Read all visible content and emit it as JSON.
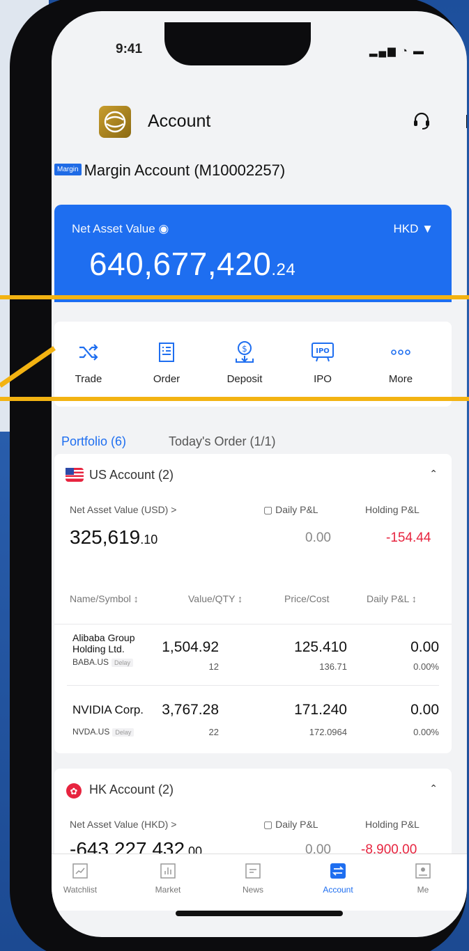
{
  "status": {
    "time": "9:41",
    "icons": "▂▄▆ ◔ ▬"
  },
  "header": {
    "title": "Account"
  },
  "account": {
    "tag": "Margin",
    "name": "Margin Account (M10002257)"
  },
  "nav": {
    "label": "Net Asset Value",
    "currency": "HKD",
    "value_main": "640,677,420",
    "value_dec": ".24"
  },
  "actions": [
    {
      "label": "Trade",
      "icon": "shuffle-icon"
    },
    {
      "label": "Order",
      "icon": "order-list-icon"
    },
    {
      "label": "Deposit",
      "icon": "deposit-icon"
    },
    {
      "label": "IPO",
      "icon": "ipo-icon"
    },
    {
      "label": "More",
      "icon": "more-dots-icon"
    }
  ],
  "tabs": {
    "portfolio": "Portfolio (6)",
    "orders": "Today's Order (1/1)"
  },
  "us": {
    "title": "US Account (2)",
    "nav_label": "Net Asset Value (USD)",
    "nav_main": "325,619",
    "nav_dec": ".10",
    "daily_label": "Daily P&L",
    "daily_value": "0.00",
    "holding_label": "Holding P&L",
    "holding_value": "-154.44",
    "columns": [
      "Name/Symbol ↕",
      "Value/QTY ↕",
      "Price/Cost",
      "Daily P&L ↕"
    ],
    "rows": [
      {
        "name1": "Alibaba Group",
        "name2": "Holding Ltd.",
        "symbol": "BABA.US",
        "delay": "Delay",
        "value": "1,504.92",
        "qty": "12",
        "price": "125.410",
        "cost": "136.71",
        "pl": "0.00",
        "pl_pct": "0.00%"
      },
      {
        "name1": "NVIDIA Corp.",
        "name2": "",
        "symbol": "NVDA.US",
        "delay": "Delay",
        "value": "3,767.28",
        "qty": "22",
        "price": "171.240",
        "cost": "172.0964",
        "pl": "0.00",
        "pl_pct": "0.00%"
      }
    ]
  },
  "hk": {
    "title": "HK Account (2)",
    "nav_label": "Net Asset Value (HKD)",
    "nav_main": "-643,227,432",
    "nav_dec": ".00",
    "daily_label": "Daily P&L",
    "daily_value": "0.00",
    "holding_label": "Holding P&L",
    "holding_value": "-8,900.00"
  },
  "tabbar": [
    {
      "label": "Watchlist",
      "icon": "watchlist-icon"
    },
    {
      "label": "Market",
      "icon": "market-icon"
    },
    {
      "label": "News",
      "icon": "news-icon"
    },
    {
      "label": "Account",
      "icon": "account-icon"
    },
    {
      "label": "Me",
      "icon": "me-icon"
    }
  ],
  "colors": {
    "accent": "#1e6ef0",
    "negative": "#e7243f",
    "highlight": "#f3b312"
  }
}
